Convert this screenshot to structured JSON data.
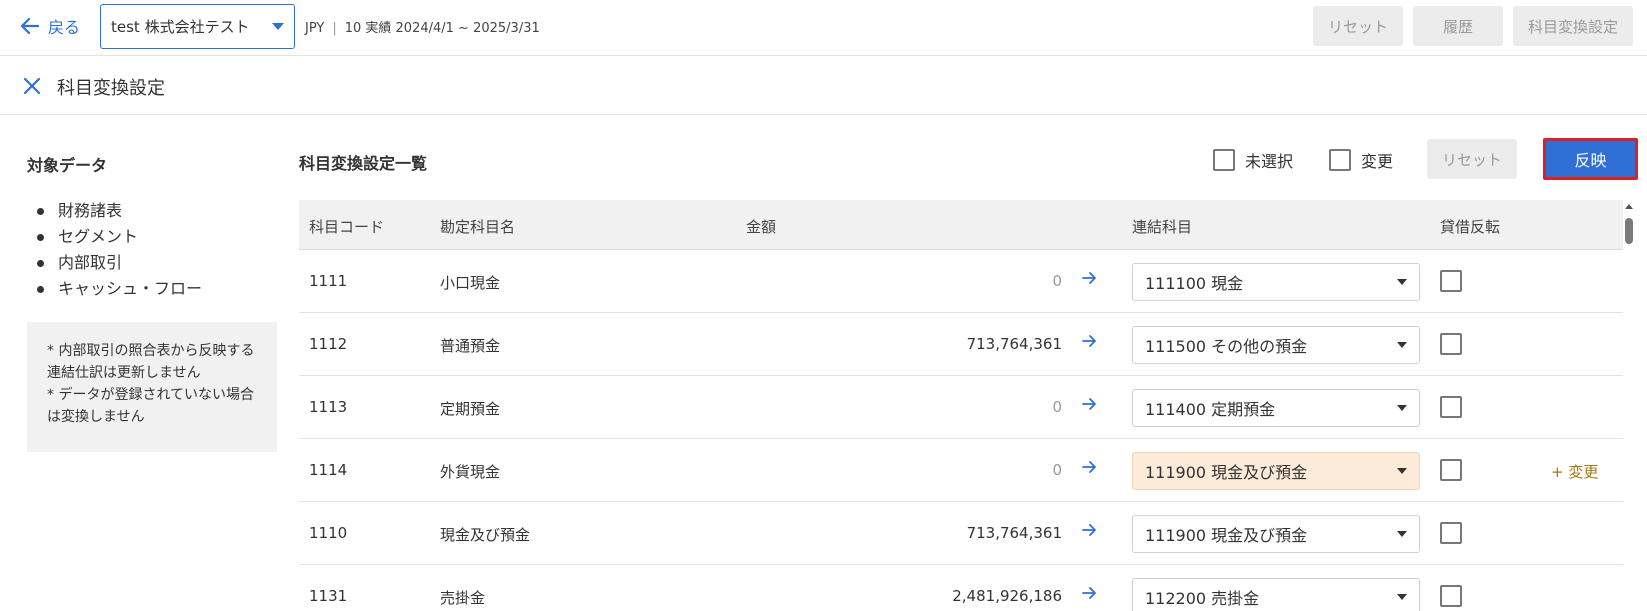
{
  "header": {
    "back_label": "戻る",
    "company": "test 株式会社テスト",
    "currency": "JPY",
    "separator": "|",
    "period": "10 実績 2024/4/1 ~ 2025/3/31",
    "buttons": {
      "reset": "リセット",
      "history": "履歴",
      "mapping": "科目変換設定"
    }
  },
  "titlebar": {
    "title": "科目変換設定"
  },
  "left": {
    "title": "対象データ",
    "items": [
      "財務諸表",
      "セグメント",
      "内部取引",
      "キャッシュ・フロー"
    ],
    "notes": [
      "* 内部取引の照合表から反映する連結仕訳は更新しません",
      "* データが登録されていない場合は変換しません"
    ]
  },
  "main": {
    "title": "科目変換設定一覧",
    "filters": {
      "unselected": "未選択",
      "changed": "変更"
    },
    "reset_label": "リセット",
    "apply_label": "反映",
    "columns": {
      "code": "科目コード",
      "name": "勘定科目名",
      "amount": "金額",
      "target": "連結科目",
      "reverse": "貸借反転"
    },
    "rows": [
      {
        "code": "1111",
        "name": "小口現金",
        "amount": "0",
        "target": "111100 現金",
        "changed": false,
        "change_label": ""
      },
      {
        "code": "1112",
        "name": "普通預金",
        "amount": "713,764,361",
        "target": "111500 その他の預金",
        "changed": false,
        "change_label": ""
      },
      {
        "code": "1113",
        "name": "定期預金",
        "amount": "0",
        "target": "111400 定期預金",
        "changed": false,
        "change_label": ""
      },
      {
        "code": "1114",
        "name": "外貨現金",
        "amount": "0",
        "target": "111900 現金及び預金",
        "changed": true,
        "change_label": "+ 変更"
      },
      {
        "code": "1110",
        "name": "現金及び預金",
        "amount": "713,764,361",
        "target": "111900 現金及び預金",
        "changed": false,
        "change_label": ""
      },
      {
        "code": "1131",
        "name": "売掛金",
        "amount": "2,481,926,186",
        "target": "112200 売掛金",
        "changed": false,
        "change_label": ""
      }
    ]
  },
  "colors": {
    "primary": "#2f6fd6",
    "highlight_border": "#e0201f",
    "changed_bg": "#fcebd8",
    "change_text": "#a07a14"
  }
}
